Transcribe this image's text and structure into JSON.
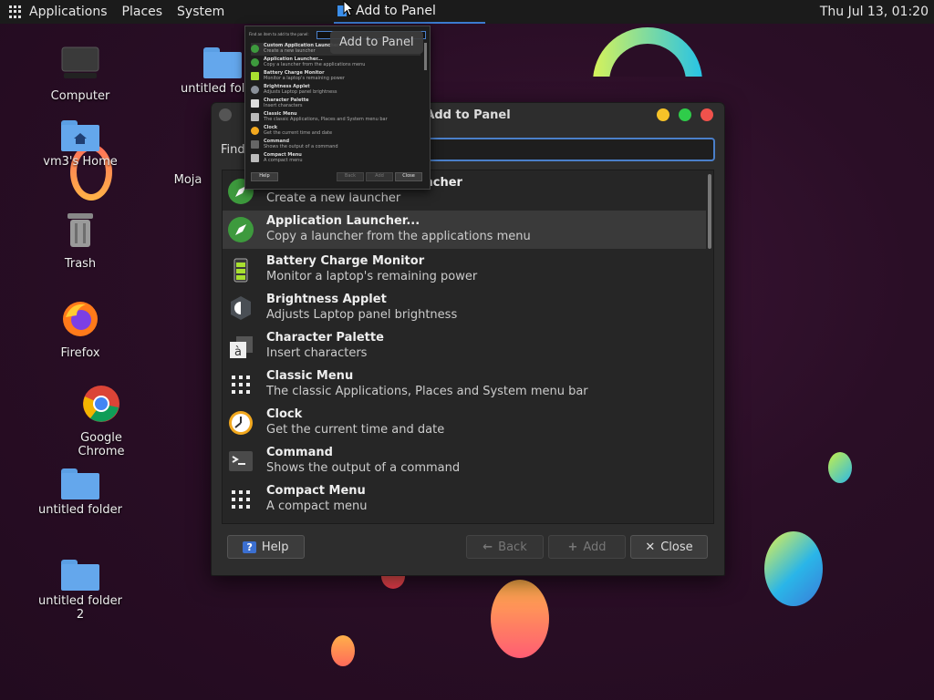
{
  "top_panel": {
    "menus": [
      "Applications",
      "Places",
      "System"
    ],
    "task_button": "Add to Panel",
    "clock": "Thu Jul 13, 01:20"
  },
  "desktop": {
    "icons": [
      "Computer",
      "vm3's Home",
      "Trash",
      "Firefox",
      "Google Chrome",
      "untitled folder",
      "untitled folder 2",
      "untitled folder",
      "Moja"
    ]
  },
  "tooltip": "Add to Panel",
  "dialog": {
    "title": "Add to Panel",
    "find_label": "Find",
    "find_value": "",
    "items": [
      {
        "name": "Custom Application Launcher",
        "desc": "Create a new launcher",
        "icon": "rocket-icon"
      },
      {
        "name": "Application Launcher...",
        "desc": "Copy a launcher from the applications menu",
        "icon": "rocket-icon"
      },
      {
        "name": "Battery Charge Monitor",
        "desc": "Monitor a laptop's remaining power",
        "icon": "battery-icon"
      },
      {
        "name": "Brightness Applet",
        "desc": "Adjusts Laptop panel brightness",
        "icon": "brightness-icon"
      },
      {
        "name": "Character Palette",
        "desc": "Insert characters",
        "icon": "character-icon"
      },
      {
        "name": "Classic Menu",
        "desc": "The classic Applications, Places and System menu bar",
        "icon": "grid-icon"
      },
      {
        "name": "Clock",
        "desc": "Get the current time and date",
        "icon": "clock-icon"
      },
      {
        "name": "Command",
        "desc": "Shows the output of a command",
        "icon": "terminal-icon"
      },
      {
        "name": "Compact Menu",
        "desc": "A compact menu",
        "icon": "grid-icon"
      }
    ],
    "buttons": {
      "help": "Help",
      "back": "Back",
      "add": "Add",
      "close": "Close"
    }
  },
  "preview": {
    "find_text": "Find an item to add to the panel:",
    "buttons": [
      "Help",
      "Back",
      "Add",
      "Close"
    ]
  }
}
